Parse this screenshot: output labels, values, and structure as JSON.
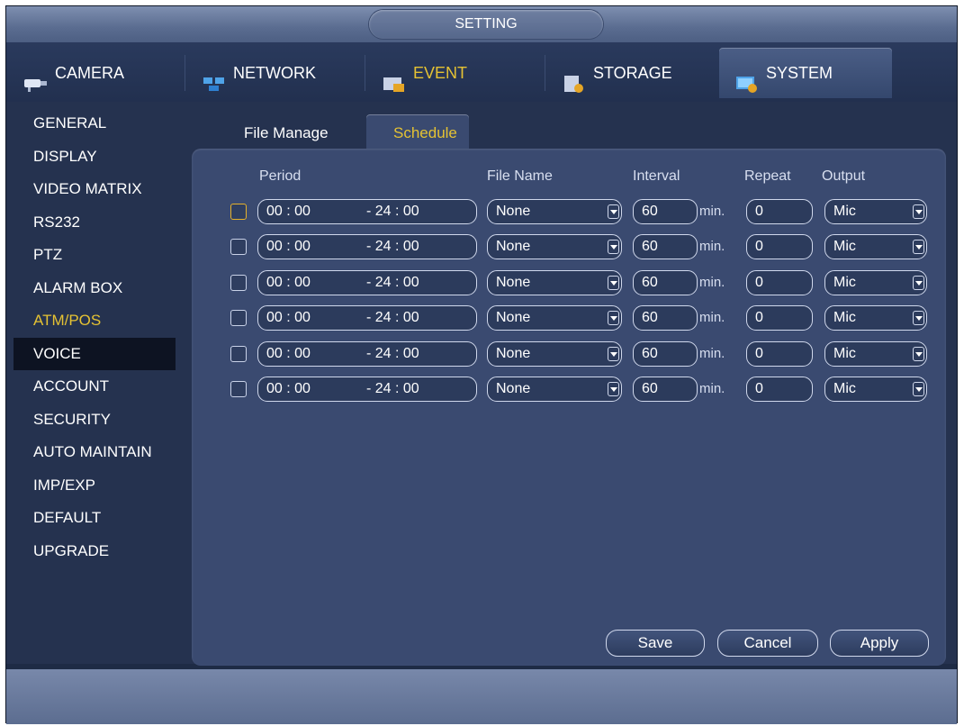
{
  "window": {
    "title": "SETTING"
  },
  "main_tabs": [
    {
      "label": "CAMERA",
      "icon": "camera-icon"
    },
    {
      "label": "NETWORK",
      "icon": "network-icon"
    },
    {
      "label": "EVENT",
      "icon": "event-icon"
    },
    {
      "label": "STORAGE",
      "icon": "storage-icon"
    },
    {
      "label": "SYSTEM",
      "icon": "system-icon",
      "active": true
    }
  ],
  "sidebar": {
    "items": [
      {
        "label": "GENERAL"
      },
      {
        "label": "DISPLAY"
      },
      {
        "label": "VIDEO MATRIX"
      },
      {
        "label": "RS232"
      },
      {
        "label": "PTZ"
      },
      {
        "label": "ALARM BOX"
      },
      {
        "label": "ATM/POS",
        "highlight": true
      },
      {
        "label": "VOICE",
        "selected": true
      },
      {
        "label": "ACCOUNT"
      },
      {
        "label": "SECURITY"
      },
      {
        "label": "AUTO MAINTAIN"
      },
      {
        "label": "IMP/EXP"
      },
      {
        "label": "DEFAULT"
      },
      {
        "label": "UPGRADE"
      }
    ]
  },
  "sub_tabs": [
    {
      "label": "File Manage"
    },
    {
      "label": "Schedule",
      "active": true
    }
  ],
  "schedule": {
    "columns": {
      "period": "Period",
      "file_name": "File Name",
      "interval": "Interval",
      "repeat": "Repeat",
      "output": "Output"
    },
    "interval_unit": "min.",
    "rows": [
      {
        "checked": false,
        "start": "00 : 00",
        "end": "- 24 : 00",
        "file_name": "None",
        "interval": "60",
        "repeat": "0",
        "output": "Mic"
      },
      {
        "checked": false,
        "start": "00 : 00",
        "end": "- 24 : 00",
        "file_name": "None",
        "interval": "60",
        "repeat": "0",
        "output": "Mic"
      },
      {
        "checked": false,
        "start": "00 : 00",
        "end": "- 24 : 00",
        "file_name": "None",
        "interval": "60",
        "repeat": "0",
        "output": "Mic"
      },
      {
        "checked": false,
        "start": "00 : 00",
        "end": "- 24 : 00",
        "file_name": "None",
        "interval": "60",
        "repeat": "0",
        "output": "Mic"
      },
      {
        "checked": false,
        "start": "00 : 00",
        "end": "- 24 : 00",
        "file_name": "None",
        "interval": "60",
        "repeat": "0",
        "output": "Mic"
      },
      {
        "checked": false,
        "start": "00 : 00",
        "end": "- 24 : 00",
        "file_name": "None",
        "interval": "60",
        "repeat": "0",
        "output": "Mic"
      }
    ]
  },
  "buttons": {
    "save": "Save",
    "cancel": "Cancel",
    "apply": "Apply"
  },
  "colors": {
    "accent": "#e5c233",
    "background": "#25324f",
    "panel": "#3a4a70"
  }
}
